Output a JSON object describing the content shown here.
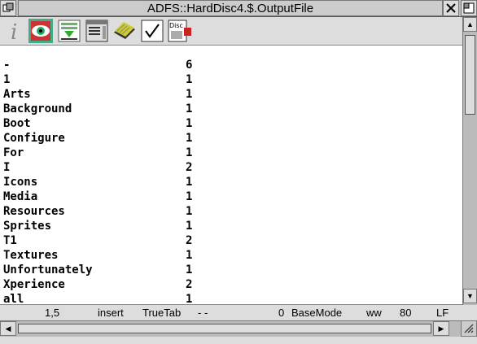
{
  "window": {
    "title": "ADFS::HardDisc4.$.OutputFile",
    "close_icon": "close-icon",
    "back_icon": "back-icon",
    "toggle_size_icon": "toggle-size-icon"
  },
  "toolbar": {
    "tools": [
      {
        "name": "info-tool",
        "icon": "info-icon"
      },
      {
        "name": "display-tool",
        "icon": "eye-icon"
      },
      {
        "name": "save-tool",
        "icon": "save-icon"
      },
      {
        "name": "find-tool",
        "icon": "window-icon"
      },
      {
        "name": "misc-tool",
        "icon": "book-icon"
      },
      {
        "name": "select-tool",
        "icon": "check-icon"
      },
      {
        "name": "disc-tool",
        "icon": "disc-icon",
        "label": "Disc"
      }
    ]
  },
  "document": {
    "lines": [
      {
        "word": "-",
        "count": "6"
      },
      {
        "word": "1",
        "count": "1"
      },
      {
        "word": "Arts",
        "count": "1"
      },
      {
        "word": "Background",
        "count": "1"
      },
      {
        "word": "Boot",
        "count": "1"
      },
      {
        "word": "Configure",
        "count": "1"
      },
      {
        "word": "For",
        "count": "1"
      },
      {
        "word": "I",
        "count": "2"
      },
      {
        "word": "Icons",
        "count": "1"
      },
      {
        "word": "Media",
        "count": "1"
      },
      {
        "word": "Resources",
        "count": "1"
      },
      {
        "word": "Sprites",
        "count": "1"
      },
      {
        "word": "T1",
        "count": "2"
      },
      {
        "word": "Textures",
        "count": "1"
      },
      {
        "word": "Unfortunately",
        "count": "1"
      },
      {
        "word": "Xperience",
        "count": "2"
      },
      {
        "word": "all",
        "count": "1"
      }
    ]
  },
  "status": {
    "position": "1,5",
    "mode": "insert",
    "tab": "TrueTab",
    "dashes": "- -",
    "markers": "0",
    "display": "BaseMode",
    "wrap": "ww",
    "width": "80",
    "line_ending": "LF"
  },
  "scrollbars": {
    "up_arrow": "▲",
    "down_arrow": "▼",
    "left_arrow": "◀",
    "right_arrow": "▶"
  }
}
